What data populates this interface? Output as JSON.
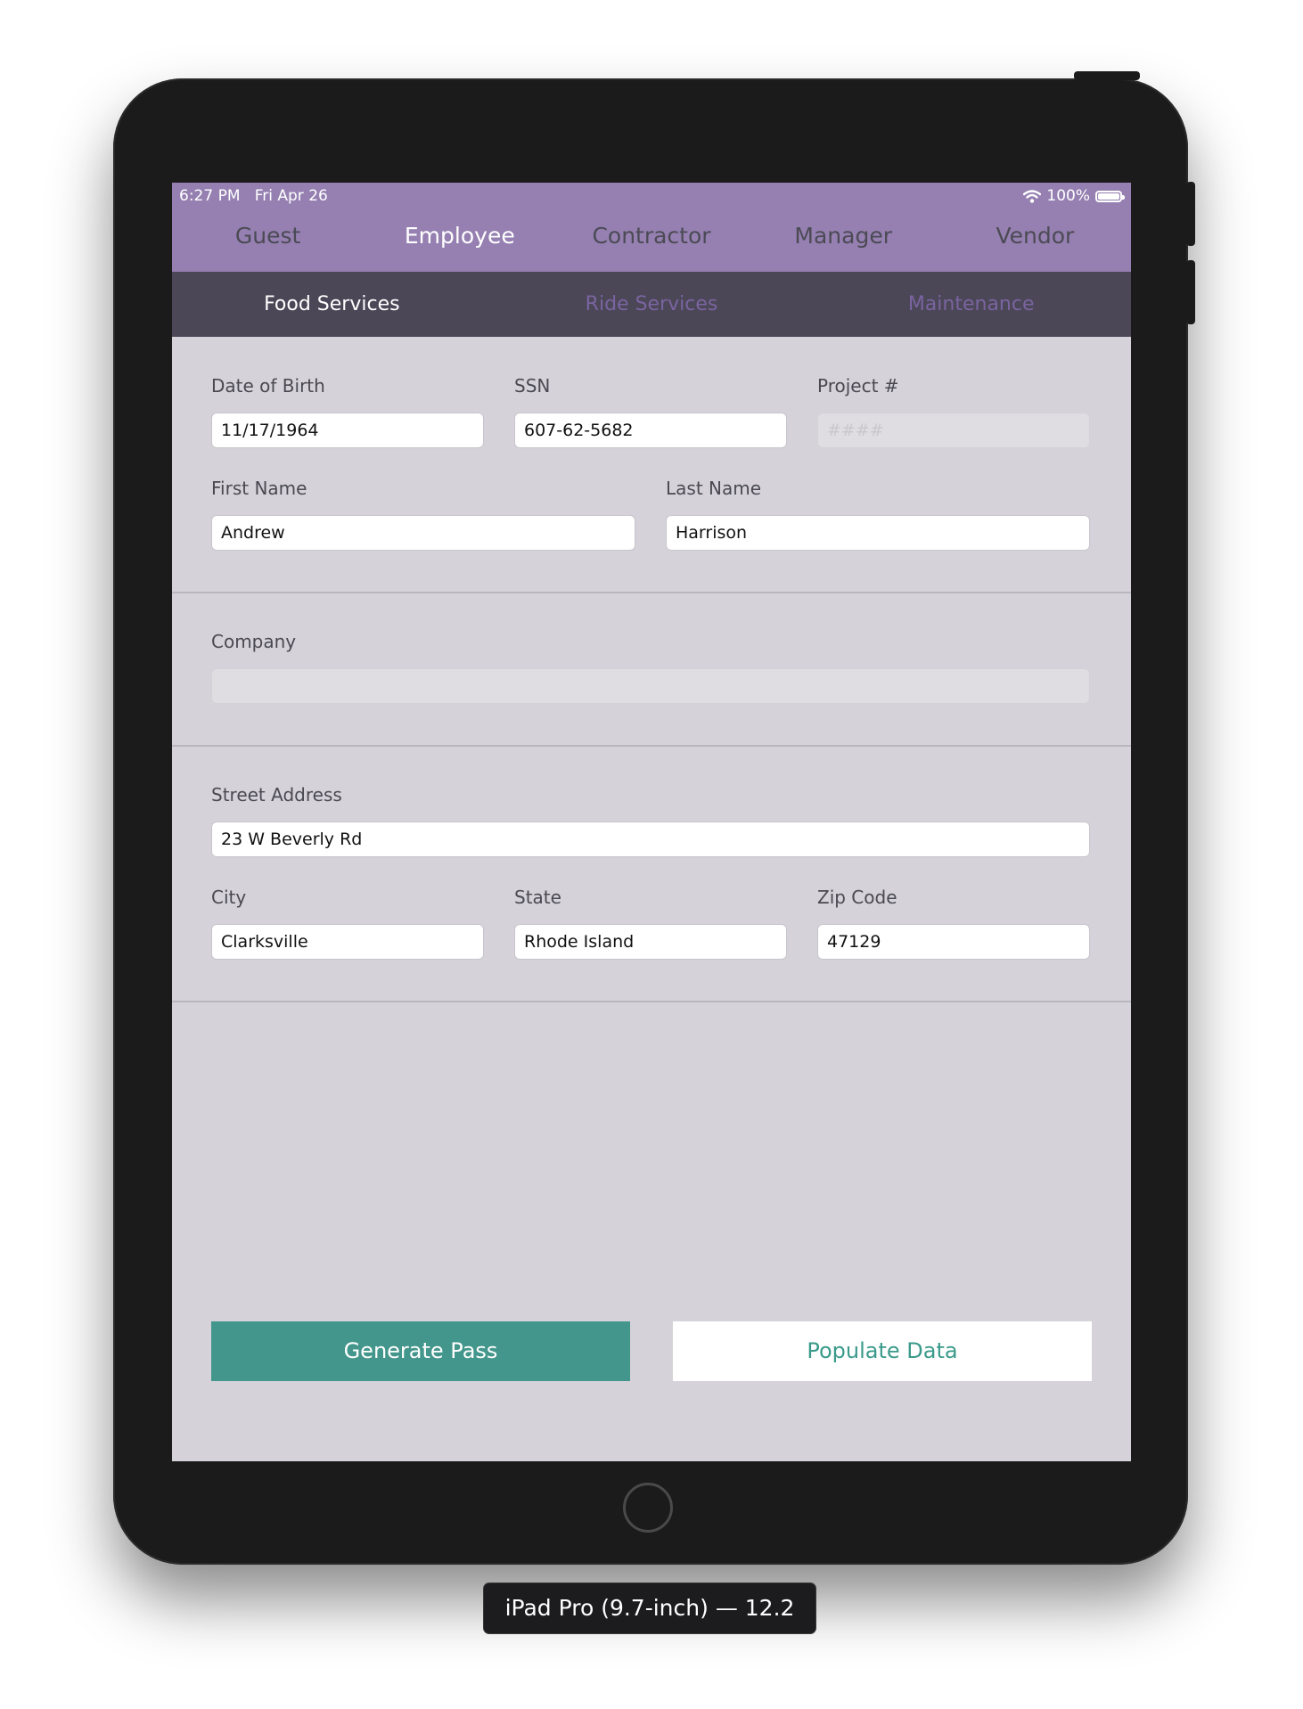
{
  "status_bar": {
    "time": "6:27 PM",
    "date": "Fri Apr 26",
    "battery": "100%",
    "wifi_icon": "wifi-icon",
    "battery_icon": "battery-icon"
  },
  "entrant_tabs": [
    {
      "label": "Guest"
    },
    {
      "label": "Employee",
      "selected": true
    },
    {
      "label": "Contractor"
    },
    {
      "label": "Manager"
    },
    {
      "label": "Vendor"
    }
  ],
  "subtype_tabs": [
    {
      "label": "Food Services",
      "selected": true
    },
    {
      "label": "Ride Services"
    },
    {
      "label": "Maintenance"
    }
  ],
  "form": {
    "dob": {
      "label": "Date of Birth",
      "value": "11/17/1964"
    },
    "ssn": {
      "label": "SSN",
      "value": "607-62-5682"
    },
    "project": {
      "label": "Project #",
      "placeholder": "####",
      "enabled": false
    },
    "first_name": {
      "label": "First Name",
      "value": "Andrew"
    },
    "last_name": {
      "label": "Last Name",
      "value": "Harrison"
    },
    "company": {
      "label": "Company",
      "value": "",
      "enabled": false
    },
    "street": {
      "label": "Street Address",
      "value": "23 W Beverly Rd"
    },
    "city": {
      "label": "City",
      "value": "Clarksville"
    },
    "state": {
      "label": "State",
      "value": "Rhode Island"
    },
    "zip": {
      "label": "Zip Code",
      "value": "47129"
    }
  },
  "buttons": {
    "generate": "Generate Pass",
    "populate": "Populate Data"
  },
  "device_caption": "iPad Pro (9.7-inch) — 12.2",
  "colors": {
    "header": "#9580b1",
    "subheader": "#4b4757",
    "accent": "#43968b",
    "background": "#d5d3d9"
  }
}
